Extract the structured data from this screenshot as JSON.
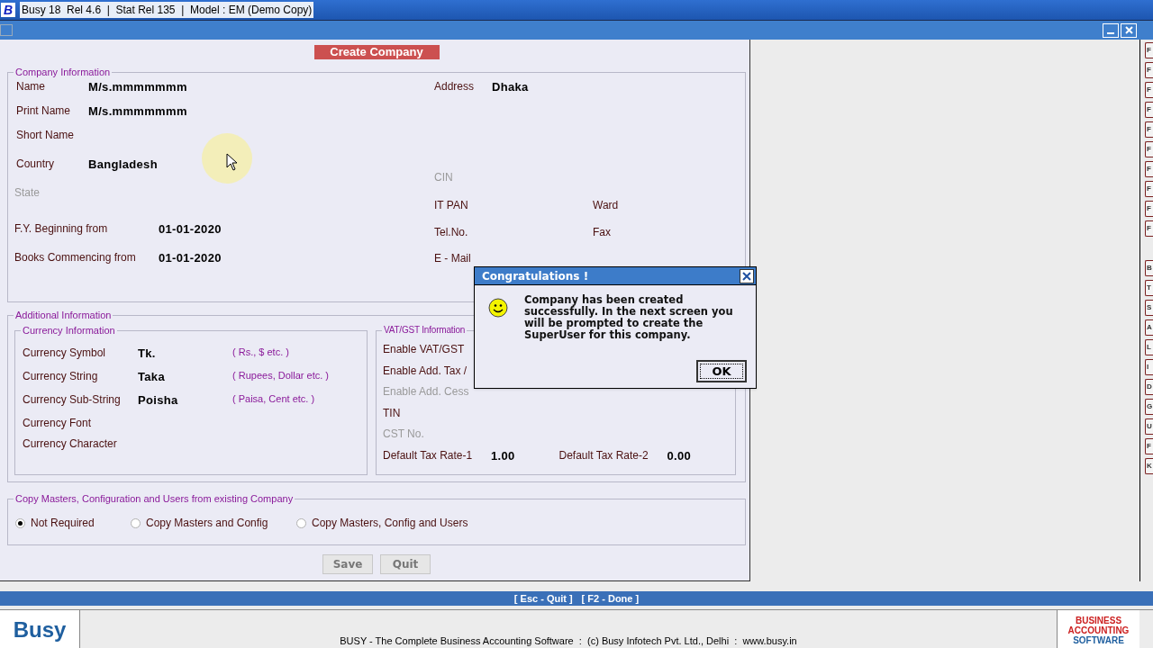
{
  "window": {
    "logo": "B",
    "title": "Busy 18  Rel 4.6  |  Stat Rel 135  |  Model : EM (Demo Copy)"
  },
  "form": {
    "title": "Create Company",
    "company_information": {
      "title": "Company Information",
      "left": [
        {
          "label": "Name",
          "value": "M/s.mmmmmmm",
          "disabled": false
        },
        {
          "label": "Print Name",
          "value": "M/s.mmmmmmm",
          "disabled": false
        },
        {
          "label": "Short Name",
          "disabled": false
        },
        {
          "label": "Country",
          "value": "Bangladesh",
          "disabled": false
        },
        {
          "label": "State",
          "disabled": true
        },
        {
          "label": "F.Y.  Beginning from",
          "value": "01-01-2020",
          "disabled": false
        },
        {
          "label": "Books Commencing from",
          "value": "01-01-2020",
          "disabled": false
        }
      ],
      "right": [
        {
          "label": "Address",
          "value": "Dhaka",
          "disabled": false
        },
        {
          "label": "CIN",
          "disabled": true
        },
        {
          "label": "IT PAN",
          "extra": "Ward",
          "disabled": false
        },
        {
          "label": "Tel.No.",
          "extra": "Fax",
          "disabled": false
        },
        {
          "label": "E - Mail",
          "disabled": false
        }
      ]
    },
    "additional_information": {
      "title": "Additional Information",
      "currency": {
        "title": "Currency Information",
        "rows": [
          {
            "label": "Currency Symbol",
            "value": "Tk.",
            "hint": "( Rs., $ etc. )"
          },
          {
            "label": "Currency String",
            "value": "Taka",
            "hint": "( Rupees, Dollar etc. )"
          },
          {
            "label": "Currency Sub-String",
            "value": "Poisha",
            "hint": "( Paisa, Cent etc. )"
          },
          {
            "label": "Currency Font"
          },
          {
            "label": "Currency Character"
          }
        ]
      },
      "vat": {
        "title": "VAT/GST Information",
        "rows": [
          {
            "label": "Enable VAT/GST",
            "disabled": false
          },
          {
            "label": "Enable Add. Tax /",
            "disabled": false
          },
          {
            "label": "Enable Add. Cess",
            "disabled": true
          },
          {
            "label": "TIN",
            "disabled": false
          },
          {
            "label": "CST No.",
            "disabled": true
          }
        ],
        "rates": [
          {
            "label": "Default Tax Rate-1",
            "value": "1.00"
          },
          {
            "label": "Default Tax Rate-2",
            "value": "0.00"
          }
        ]
      }
    },
    "copy": {
      "title": "Copy Masters, Configuration and Users from existing Company",
      "options": [
        {
          "label": "Not Required",
          "selected": true
        },
        {
          "label": "Copy Masters and Config",
          "selected": false
        },
        {
          "label": "Copy Masters, Config and Users",
          "selected": false
        }
      ]
    },
    "buttons": [
      "Save",
      "Quit"
    ]
  },
  "side_keys": [
    {
      "label": "F"
    },
    {
      "label": "F"
    },
    {
      "label": "F"
    },
    {
      "label": "F"
    },
    {
      "label": "F"
    },
    {
      "label": "F"
    },
    {
      "label": "F"
    },
    {
      "label": "F"
    },
    {
      "label": "F"
    },
    {
      "label": "F"
    },
    {
      "label": "B",
      "group_start": true
    },
    {
      "label": "T"
    },
    {
      "label": "S"
    },
    {
      "label": "A"
    },
    {
      "label": "L"
    },
    {
      "label": "I"
    },
    {
      "label": "D"
    },
    {
      "label": "G"
    },
    {
      "label": "U"
    },
    {
      "label": "F"
    },
    {
      "label": "K"
    }
  ],
  "hint_bar": [
    "[ Esc - Quit ]",
    "[ F2 - Done ]"
  ],
  "footer": {
    "logo": "Busy",
    "text": "BUSY - The Complete Business Accounting Software  :  (c) Busy Infotech Pvt. Ltd., Delhi  :  www.busy.in",
    "tagline": [
      "BUSINESS",
      "ACCOUNTING",
      "SOFTWARE"
    ]
  },
  "dialog": {
    "title": "Congratulations !",
    "message": "Company has been created successfully. In the next screen you will be prompted to create the SuperUser for this company.",
    "button": "OK"
  }
}
